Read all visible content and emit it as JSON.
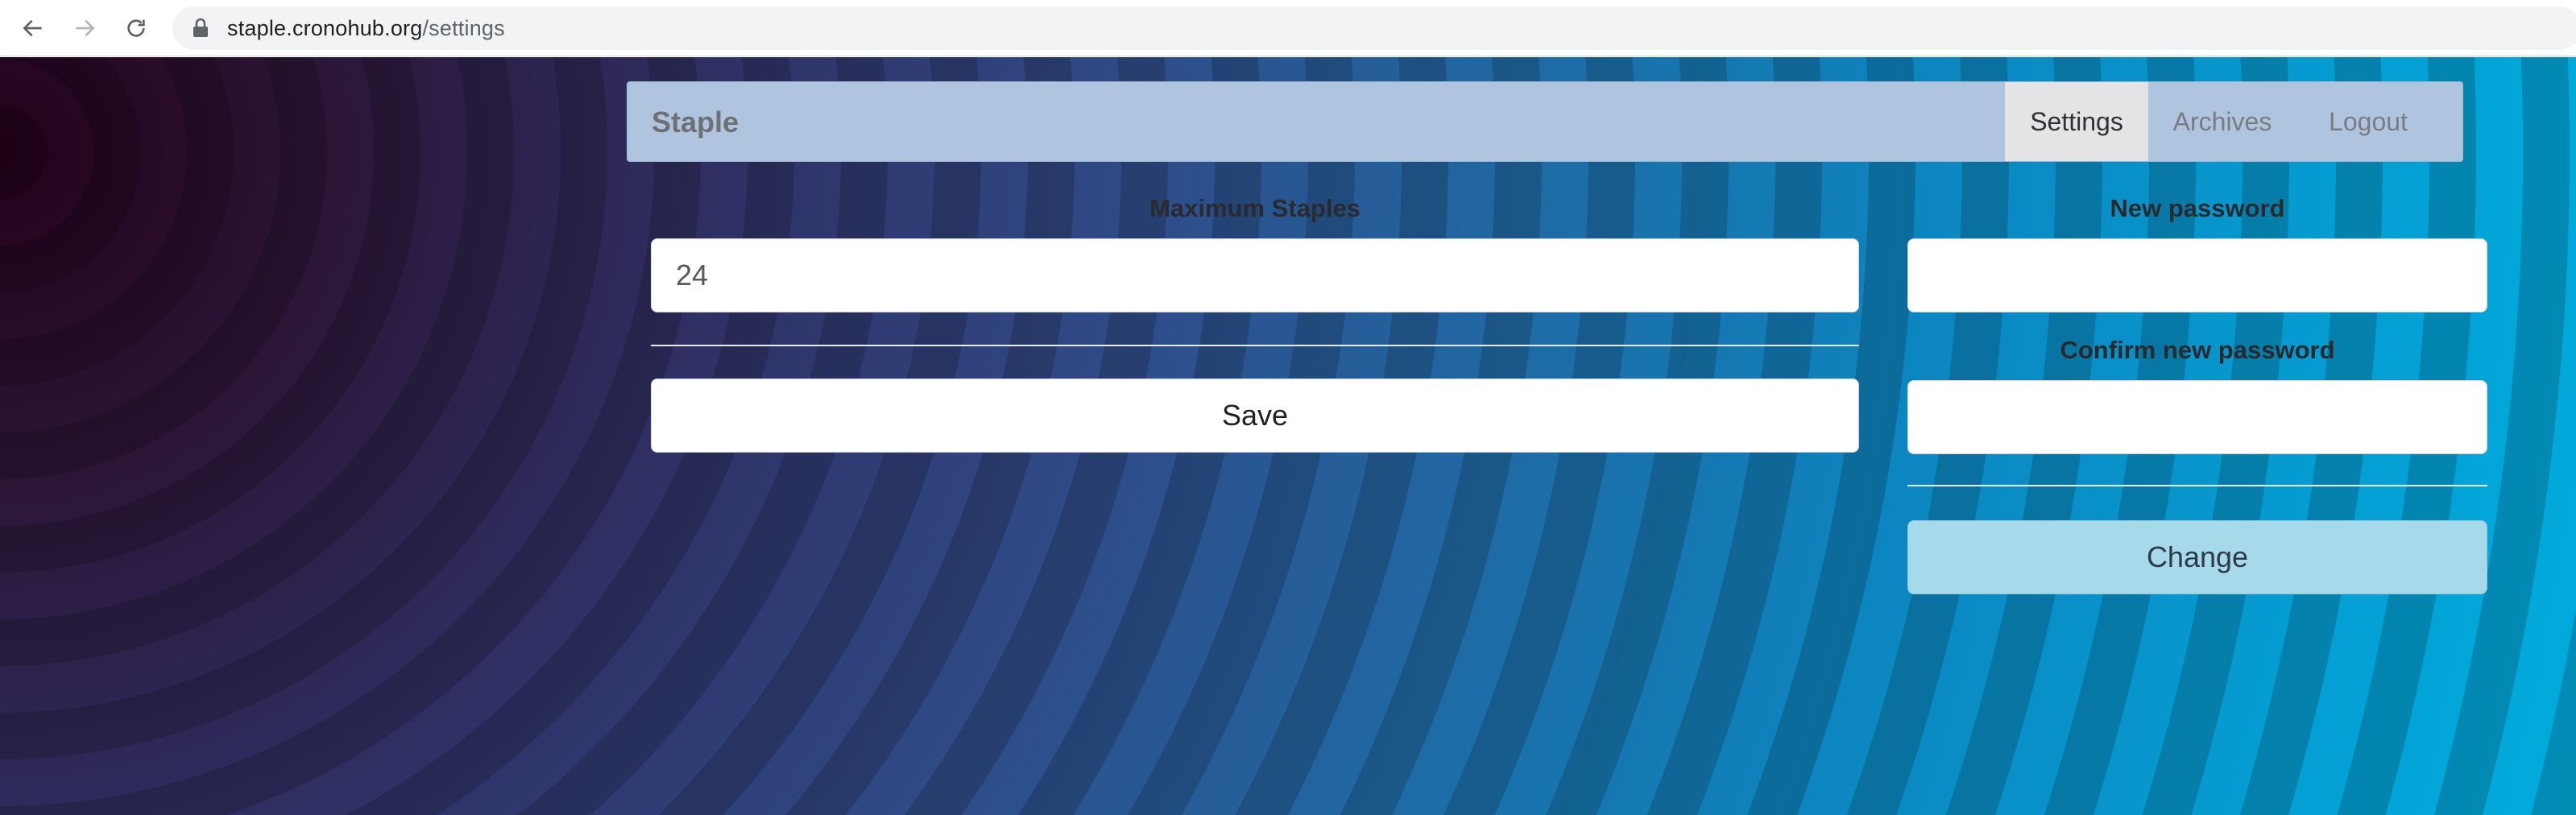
{
  "browser": {
    "url_host": "staple.cronohub.org",
    "url_path": "/settings",
    "icons": [
      "back-arrow-icon",
      "forward-arrow-icon",
      "reload-icon",
      "lock-icon"
    ]
  },
  "navbar": {
    "brand": "Staple",
    "links": {
      "settings": "Settings",
      "archives": "Archives",
      "logout": "Logout"
    },
    "active_link": "Settings"
  },
  "staples_form": {
    "label": "Maximum Staples",
    "value": "24",
    "save_label": "Save"
  },
  "password_form": {
    "new_password_label": "New password",
    "new_password_value": "",
    "confirm_label": "Confirm new password",
    "confirm_value": "",
    "change_label": "Change"
  },
  "colors": {
    "navbar_bg": "#afc4df",
    "active_tab_bg": "#e4e4e6",
    "change_button_bg": "#a6d9ea"
  }
}
